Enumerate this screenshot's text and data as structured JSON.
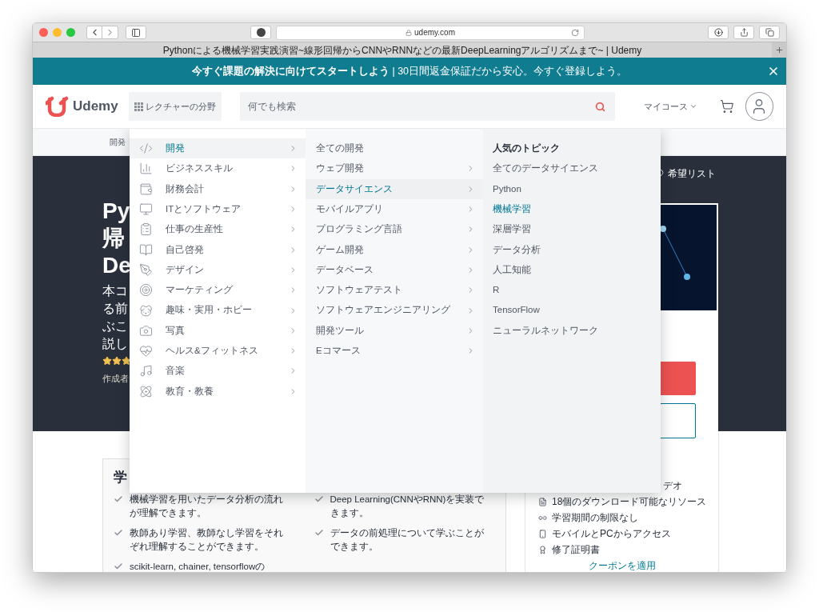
{
  "browser": {
    "url": "udemy.com",
    "tab_title": "Pythonによる機械学習実践演習~線形回帰からCNNやRNNなどの最新DeepLearningアルゴリズムまで~ | Udemy"
  },
  "banner": {
    "text": "**今すぐ課題の解決に向けてスタートしよう** | 30日間返金保証だから安心。今すぐ登録しよう。"
  },
  "header": {
    "logo": "Udemy",
    "categories_button": "レクチャーの分野",
    "search": {
      "placeholder": "何でも検索"
    },
    "my_courses": "マイコース"
  },
  "subnav": [
    {
      "label": "開発"
    }
  ],
  "hero": {
    "title_lines": [
      "Py",
      "帰",
      "De"
    ],
    "subtitle_lines": [
      "本コ",
      "る前",
      "ぶこ",
      "説し"
    ],
    "stars": 3,
    "author_label": "作成者",
    "wishlist": "希望リスト"
  },
  "learn_box": {
    "heading": "学",
    "columns": [
      [
        "機械学習を用いたデータ分析の流れが理解できます。",
        "教師あり学習、教師なし学習をそれぞれ理解することができます。",
        "scikit-learn, chainer, tensorflowの"
      ],
      [
        "Deep Learning(CNNやRNN)を実装できます。",
        "データの前処理について学ぶことができます。"
      ]
    ]
  },
  "sidebar_card": {
    "partial_item": "デオ",
    "includes": [
      "18個のダウンロード可能なリソース",
      "学習期間の制限なし",
      "モバイルとPCからアクセス",
      "修了証明書"
    ],
    "coupon_link": "クーポンを適用"
  },
  "mega_menu": {
    "categories": [
      {
        "label": "開発",
        "selected": true
      },
      {
        "label": "ビジネススキル",
        "selected": false
      },
      {
        "label": "財務会計",
        "selected": false
      },
      {
        "label": "ITとソフトウェア",
        "selected": false
      },
      {
        "label": "仕事の生産性",
        "selected": false
      },
      {
        "label": "自己啓発",
        "selected": false
      },
      {
        "label": "デザイン",
        "selected": false
      },
      {
        "label": "マーケティング",
        "selected": false
      },
      {
        "label": "趣味・実用・ホビー",
        "selected": false
      },
      {
        "label": "写真",
        "selected": false
      },
      {
        "label": "ヘルス&フィットネス",
        "selected": false
      },
      {
        "label": "音楽",
        "selected": false
      },
      {
        "label": "教育・教養",
        "selected": false
      }
    ],
    "subcategories": [
      {
        "label": "全ての開発",
        "selected": false,
        "has_submenu": false
      },
      {
        "label": "ウェブ開発",
        "selected": false,
        "has_submenu": true
      },
      {
        "label": "データサイエンス",
        "selected": true,
        "has_submenu": true
      },
      {
        "label": "モバイルアプリ",
        "selected": false,
        "has_submenu": true
      },
      {
        "label": "プログラミング言語",
        "selected": false,
        "has_submenu": true
      },
      {
        "label": "ゲーム開発",
        "selected": false,
        "has_submenu": true
      },
      {
        "label": "データベース",
        "selected": false,
        "has_submenu": true
      },
      {
        "label": "ソフトウェアテスト",
        "selected": false,
        "has_submenu": true
      },
      {
        "label": "ソフトウェアエンジニアリング",
        "selected": false,
        "has_submenu": true
      },
      {
        "label": "開発ツール",
        "selected": false,
        "has_submenu": true
      },
      {
        "label": "Eコマース",
        "selected": false,
        "has_submenu": true
      }
    ],
    "topics_heading": "人気のトピック",
    "topics": [
      {
        "label": "全てのデータサイエンス",
        "selected": false
      },
      {
        "label": "Python",
        "selected": false
      },
      {
        "label": "機械学習",
        "selected": true
      },
      {
        "label": "深層学習",
        "selected": false
      },
      {
        "label": "データ分析",
        "selected": false
      },
      {
        "label": "人工知能",
        "selected": false
      },
      {
        "label": "R",
        "selected": false
      },
      {
        "label": "TensorFlow",
        "selected": false
      },
      {
        "label": "ニューラルネットワーク",
        "selected": false
      }
    ]
  }
}
